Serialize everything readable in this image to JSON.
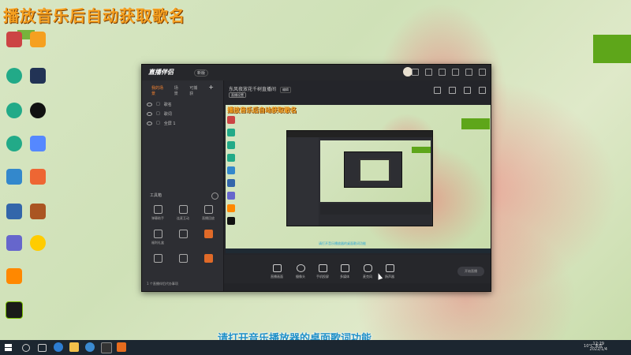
{
  "overlay_title": "播放音乐后自动获取歌名",
  "subtitle": "请打开音乐播放器的桌面歌词功能",
  "app": {
    "logo": "直播伴侣",
    "badge": "新版",
    "left_tabs": [
      "我的场景",
      "场景",
      "可捕获"
    ],
    "scenes": [
      "歌名",
      "歌词",
      "全屏 1"
    ],
    "toolbox_label": "工具箱",
    "tools": [
      {
        "label": "弹幕助手",
        "orange": false
      },
      {
        "label": "连麦互动",
        "orange": false
      },
      {
        "label": "直播回放",
        "orange": false
      },
      {
        "label": "福利礼盒",
        "orange": false
      },
      {
        "label": "",
        "orange": false
      },
      {
        "label": "",
        "orange": true
      },
      {
        "label": "",
        "orange": false
      },
      {
        "label": "",
        "orange": false
      },
      {
        "label": "",
        "orange": true
      }
    ],
    "footer": "1 个直播伴侣代办事项",
    "scene_name": "东风夜放花千树直播间",
    "scene_pill": "编辑",
    "sub_pill": "直播设置",
    "controls": [
      "直播画面",
      "摄像头",
      "手机投屏",
      "多媒体",
      "麦克风",
      "扬声器"
    ],
    "start_button": "开始直播"
  },
  "taskbar": {
    "weather": "10°C 多云",
    "time": "12:29",
    "date": "2022/1/4"
  }
}
